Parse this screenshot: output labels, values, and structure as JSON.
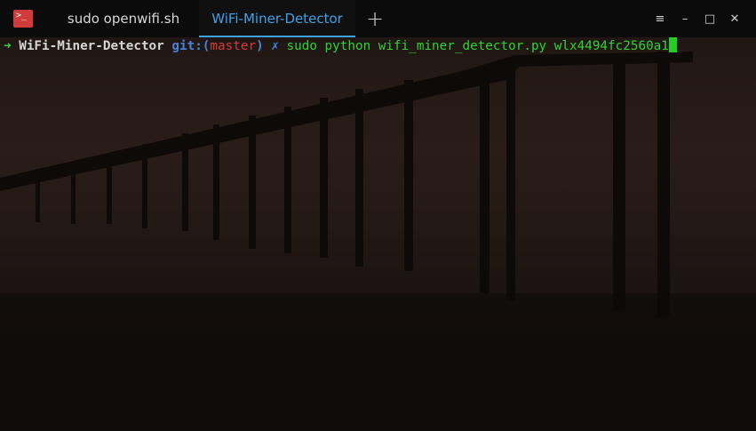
{
  "window": {
    "tabs": [
      {
        "label": "sudo openwifi.sh"
      },
      {
        "label": "WiFi-Miner-Detector"
      }
    ],
    "new_tab_symbol": "+",
    "controls": {
      "menu": "≡",
      "minimize": "–",
      "maximize": "□",
      "close": "✕"
    }
  },
  "terminal": {
    "prompt_arrow": "➜",
    "directory": "WiFi-Miner-Detector",
    "git_prefix": "git:(",
    "branch": "master",
    "git_suffix": ")",
    "dirty_marker": "✗",
    "command": "sudo python wifi_miner_detector.py wlx4494fc2560a1"
  },
  "colors": {
    "accent": "#3ea2e8",
    "prompt_green": "#3fcf45",
    "git_blue": "#4b82d8",
    "branch_red": "#d33a3a",
    "command_green": "#2fd22f"
  }
}
